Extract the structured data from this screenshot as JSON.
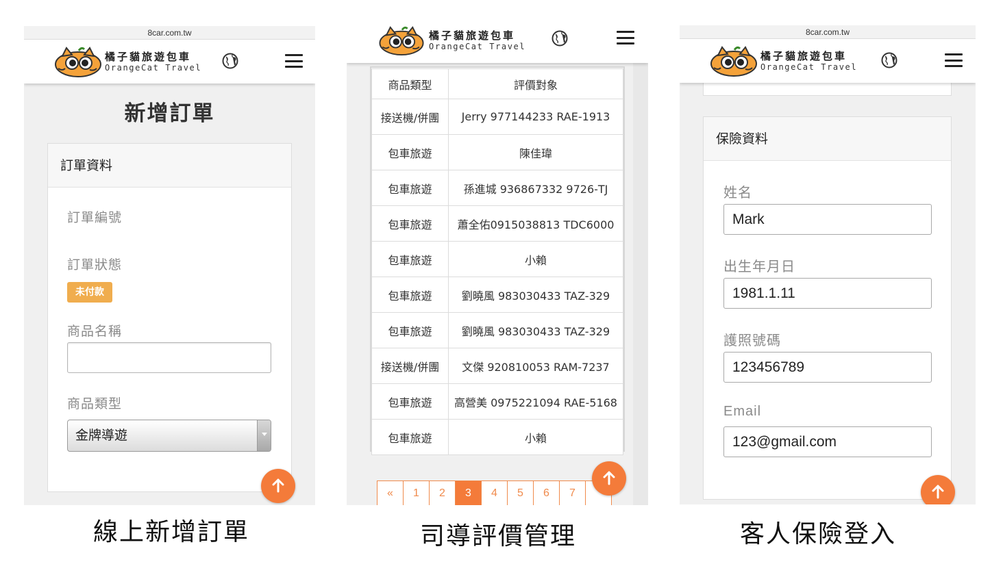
{
  "panels": {
    "order_form": {
      "url": "8car.com.tw",
      "logo": {
        "zh": "橘子貓旅遊包車",
        "en": "OrangeCat Travel"
      },
      "page_title": "新增訂單",
      "card_title": "訂單資料",
      "fields": {
        "order_no_label": "訂單編號",
        "status_label": "訂單狀態",
        "status_badge": "未付款",
        "product_name_label": "商品名稱",
        "product_name_value": "",
        "product_type_label": "商品類型",
        "product_type_value": "金牌導遊"
      },
      "caption": "線上新增訂單"
    },
    "review_mgmt": {
      "logo": {
        "zh": "橘子貓旅遊包車",
        "en": "OrangeCat Travel"
      },
      "table": {
        "headers": [
          "商品類型",
          "評價對象"
        ],
        "rows": [
          [
            "接送機/併團",
            "Jerry 977144233 RAE-1913"
          ],
          [
            "包車旅遊",
            "陳佳瑋"
          ],
          [
            "包車旅遊",
            "孫進城 936867332 9726-TJ"
          ],
          [
            "包車旅遊",
            "蕭全佑0915038813 TDC6000"
          ],
          [
            "包車旅遊",
            "小賴"
          ],
          [
            "包車旅遊",
            "劉曉風 983030433 TAZ-329"
          ],
          [
            "包車旅遊",
            "劉曉風 983030433 TAZ-329"
          ],
          [
            "接送機/併團",
            "文傑 920810053 RAM-7237"
          ],
          [
            "包車旅遊",
            "高營美 0975221094 RAE-5168"
          ],
          [
            "包車旅遊",
            "小賴"
          ]
        ]
      },
      "pagination": {
        "prev": "«",
        "pages": [
          "1",
          "2",
          "3",
          "4",
          "5",
          "6",
          "7"
        ],
        "current": "3"
      },
      "caption": "司導評價管理"
    },
    "insurance": {
      "url": "8car.com.tw",
      "logo": {
        "zh": "橘子貓旅遊包車",
        "en": "OrangeCat Travel"
      },
      "card_title": "保險資料",
      "fields": {
        "name_label": "姓名",
        "name_value": "Mark",
        "dob_label": "出生年月日",
        "dob_value": "1981.1.11",
        "passport_label": "護照號碼",
        "passport_value": "123456789",
        "email_label": "Email",
        "email_value": "123@gmail.com"
      },
      "caption": "客人保險登入"
    }
  },
  "colors": {
    "accent": "#f47b3a",
    "badge": "#f0ad4e",
    "panel_bg": "#f0f0f0"
  },
  "icons": [
    "orangecat-logo-icon",
    "globe-icon",
    "hamburger-menu-icon",
    "arrow-up-icon"
  ]
}
